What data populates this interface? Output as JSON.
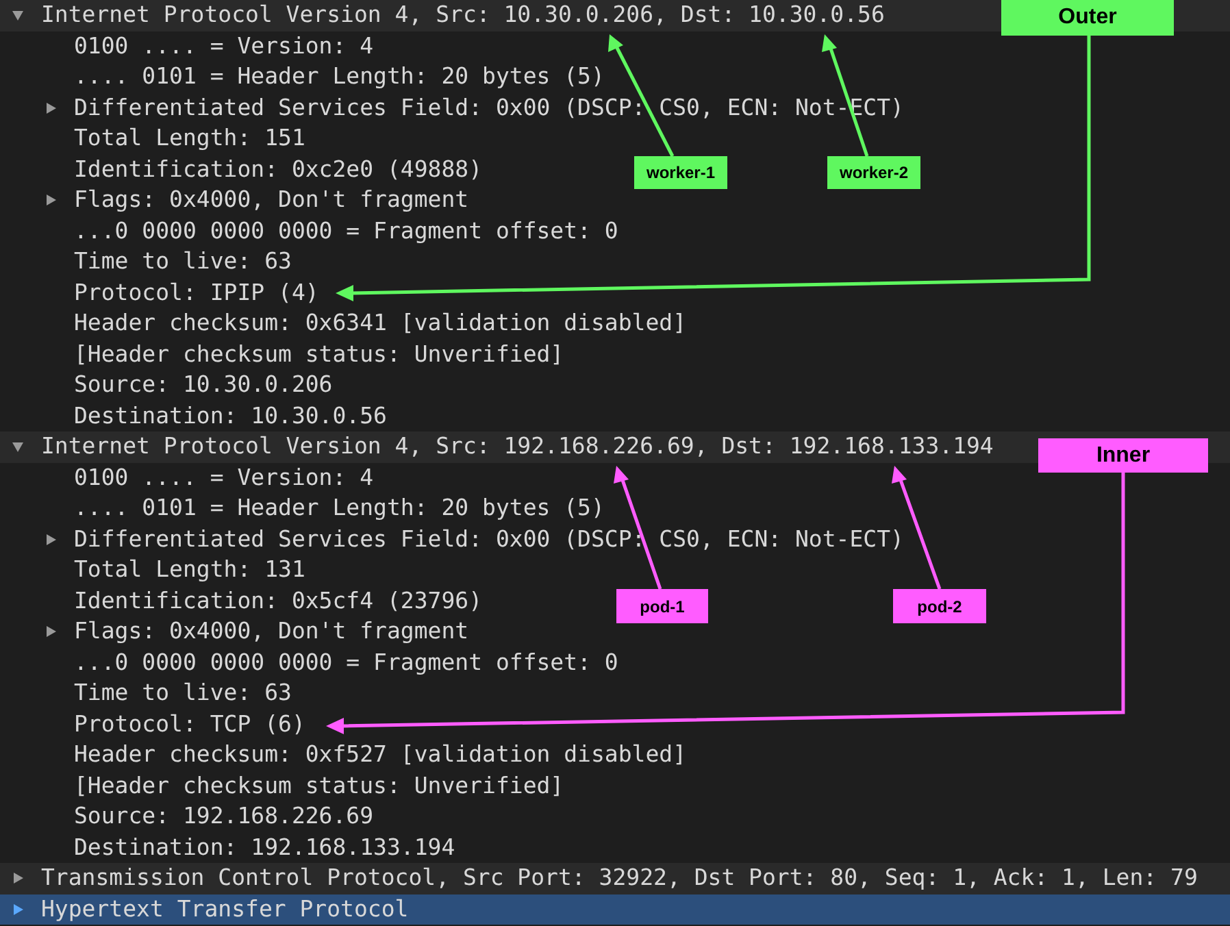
{
  "tree": [
    {
      "text": "Internet Protocol Version 4, Src: 10.30.0.206, Dst: 10.30.0.56",
      "expanded": true,
      "selected": false,
      "children": [
        {
          "text": "0100 .... = Version: 4",
          "selected": false
        },
        {
          "text": ".... 0101 = Header Length: 20 bytes (5)",
          "selected": false
        },
        {
          "text": "Differentiated Services Field: 0x00 (DSCP: CS0, ECN: Not-ECT)",
          "expanded": false,
          "selected": false
        },
        {
          "text": "Total Length: 151",
          "selected": false
        },
        {
          "text": "Identification: 0xc2e0 (49888)",
          "selected": false
        },
        {
          "text": "Flags: 0x4000, Don't fragment",
          "expanded": false,
          "selected": false
        },
        {
          "text": "...0 0000 0000 0000 = Fragment offset: 0",
          "selected": false
        },
        {
          "text": "Time to live: 63",
          "selected": false
        },
        {
          "text": "Protocol: IPIP (4)",
          "selected": false
        },
        {
          "text": "Header checksum: 0x6341 [validation disabled]",
          "selected": false
        },
        {
          "text": "[Header checksum status: Unverified]",
          "selected": false
        },
        {
          "text": "Source: 10.30.0.206",
          "selected": false
        },
        {
          "text": "Destination: 10.30.0.56",
          "selected": false
        }
      ]
    },
    {
      "text": "Internet Protocol Version 4, Src: 192.168.226.69, Dst: 192.168.133.194",
      "expanded": true,
      "selected": false,
      "children": [
        {
          "text": "0100 .... = Version: 4",
          "selected": false
        },
        {
          "text": ".... 0101 = Header Length: 20 bytes (5)",
          "selected": false
        },
        {
          "text": "Differentiated Services Field: 0x00 (DSCP: CS0, ECN: Not-ECT)",
          "expanded": false,
          "selected": false
        },
        {
          "text": "Total Length: 131",
          "selected": false
        },
        {
          "text": "Identification: 0x5cf4 (23796)",
          "selected": false
        },
        {
          "text": "Flags: 0x4000, Don't fragment",
          "expanded": false,
          "selected": false
        },
        {
          "text": "...0 0000 0000 0000 = Fragment offset: 0",
          "selected": false
        },
        {
          "text": "Time to live: 63",
          "selected": false
        },
        {
          "text": "Protocol: TCP (6)",
          "selected": false
        },
        {
          "text": "Header checksum: 0xf527 [validation disabled]",
          "selected": false
        },
        {
          "text": "[Header checksum status: Unverified]",
          "selected": false
        },
        {
          "text": "Source: 192.168.226.69",
          "selected": false
        },
        {
          "text": "Destination: 192.168.133.194",
          "selected": false
        }
      ]
    },
    {
      "text": "Transmission Control Protocol, Src Port: 32922, Dst Port: 80, Seq: 1, Ack: 1, Len: 79",
      "expanded": false,
      "selected": false
    },
    {
      "text": "Hypertext Transfer Protocol",
      "expanded": false,
      "selected": true
    }
  ],
  "annotations": [
    {
      "label": "Outer",
      "color": "#5ff75f"
    },
    {
      "label": "worker-1",
      "color": "#5ff75f"
    },
    {
      "label": "worker-2",
      "color": "#5ff75f"
    },
    {
      "label": "Inner",
      "color": "#ff5cff"
    },
    {
      "label": "pod-1",
      "color": "#ff5cff"
    },
    {
      "label": "pod-2",
      "color": "#ff5cff"
    }
  ]
}
